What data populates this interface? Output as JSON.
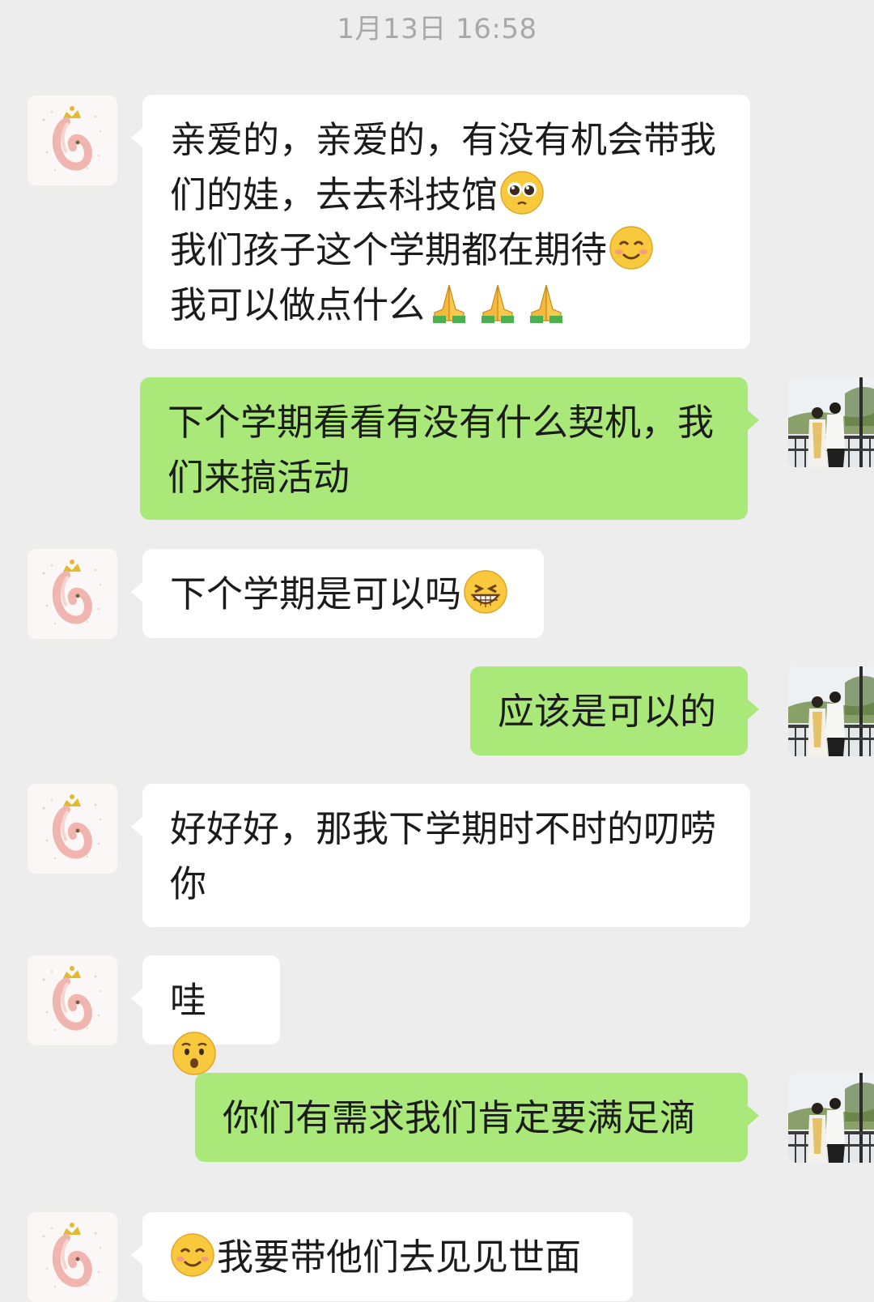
{
  "timestamp": "1月13日 16:58",
  "messages": [
    {
      "side": "in",
      "lines": [
        "亲爱的，亲爱的，有没有机会带我",
        "们的娃，去去科技馆",
        "我们孩子这个学期都在期待",
        "我可以做点什么"
      ],
      "emojis": [
        "pleading-face",
        "smiling-face",
        "folded-hands",
        "folded-hands",
        "folded-hands"
      ]
    },
    {
      "side": "out",
      "lines": [
        "下个学期看看有没有什么契机，我",
        "们来搞活动"
      ]
    },
    {
      "side": "in",
      "lines": [
        "下个学期是可以吗"
      ],
      "emojis": [
        "grinning-face"
      ]
    },
    {
      "side": "out",
      "lines": [
        "应该是可以的"
      ]
    },
    {
      "side": "in",
      "lines": [
        "好好好，那我下学期时不时的叨唠",
        "你"
      ]
    },
    {
      "side": "in",
      "lines": [
        "哇"
      ],
      "emojis": [
        "surprised-face"
      ]
    },
    {
      "side": "out",
      "lines": [
        "你们有需求我们肯定要满足滴"
      ]
    },
    {
      "side": "in",
      "lines": [
        "我要带他们去见见世面"
      ],
      "emojis": [
        "smiling-face"
      ]
    }
  ],
  "colors": {
    "background": "#ededed",
    "incoming_bubble": "#ffffff",
    "outgoing_bubble": "#a9e879",
    "timestamp_text": "#a8a8a8"
  }
}
